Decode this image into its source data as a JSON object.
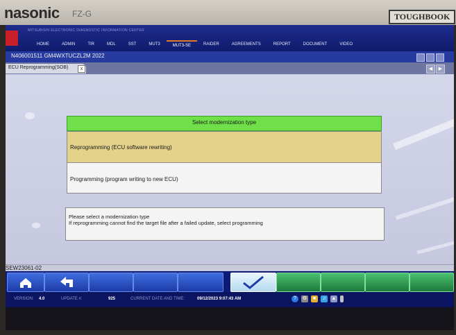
{
  "device": {
    "brand": "nasonic",
    "model": "FZ-G",
    "badge": "TOUGHBOOK"
  },
  "app": {
    "title_small": "MITSUBISHI ELECTRONIC DIAGNOSTIC INFORMATION CENTER",
    "menu": [
      "HOME",
      "ADMIN",
      "TIR",
      "MDL",
      "SST",
      "MUT3",
      "MUT3-SE",
      "RAIDER",
      "AGREEMENTS",
      "REPORT",
      "DOCUMENT",
      "VIDEO"
    ],
    "menu_active": "MUT3-SE"
  },
  "window": {
    "title": "N406001511  GM4WXTUCZL2M 2022"
  },
  "tab": {
    "label": "ECU Reprogramming(SOB)",
    "close": "x"
  },
  "panel": {
    "header": "Select modernization type",
    "options": [
      {
        "label": "Reprogramming (ECU software rewriting)",
        "selected": true
      },
      {
        "label": "Programming (program writing to new ECU)",
        "selected": false
      }
    ],
    "message": [
      "Please select a modernization type",
      "If reprogramming cannot find the target file after a failed update, select programming"
    ]
  },
  "code": "SEW23061-02",
  "buttons": {
    "home_icon": "home-icon",
    "back_icon": "back-arrow-icon",
    "confirm_icon": "checkmark-icon"
  },
  "status": {
    "version_label": "VERSION:",
    "version_value": "4.0",
    "update_label": "UPDATE #:",
    "update_value": "925",
    "datetime_label": "CURRENT DATE AND TIME:",
    "datetime_value": "09/12/2023 9:07:43 AM"
  },
  "colors": {
    "header_green": "#6fe04a",
    "selected_option": "#e4d18a",
    "screen_blue": "#0e1e7a",
    "button_blue": "#2d55c8",
    "button_green": "#2f9a52"
  }
}
